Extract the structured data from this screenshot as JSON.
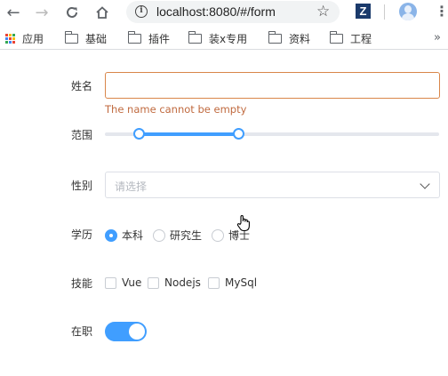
{
  "browser": {
    "url": "localhost:8080/#/form",
    "extension_letter": "Z",
    "bookmarks": [
      {
        "label": "应用",
        "icon": "apps-grid-icon"
      },
      {
        "label": "基础",
        "icon": "folder-icon"
      },
      {
        "label": "插件",
        "icon": "folder-icon"
      },
      {
        "label": "装x专用",
        "icon": "folder-icon"
      },
      {
        "label": "资料",
        "icon": "folder-icon"
      },
      {
        "label": "工程",
        "icon": "folder-icon"
      }
    ],
    "more": "»"
  },
  "form": {
    "name": {
      "label": "姓名",
      "value": "",
      "error": "The name cannot be empty"
    },
    "range": {
      "label": "范围",
      "low_fraction": 0.1,
      "high_fraction": 0.4
    },
    "gender": {
      "label": "性别",
      "placeholder": "请选择"
    },
    "education": {
      "label": "学历",
      "options": [
        "本科",
        "研究生",
        "博士"
      ],
      "selected": "本科"
    },
    "skills": {
      "label": "技能",
      "options": [
        "Vue",
        "Nodejs",
        "MySql"
      ],
      "checked": []
    },
    "employed": {
      "label": "在职",
      "on": true
    }
  },
  "colors": {
    "accent": "#409eff",
    "error": "#c06a3f",
    "error_border": "#d9864a"
  }
}
